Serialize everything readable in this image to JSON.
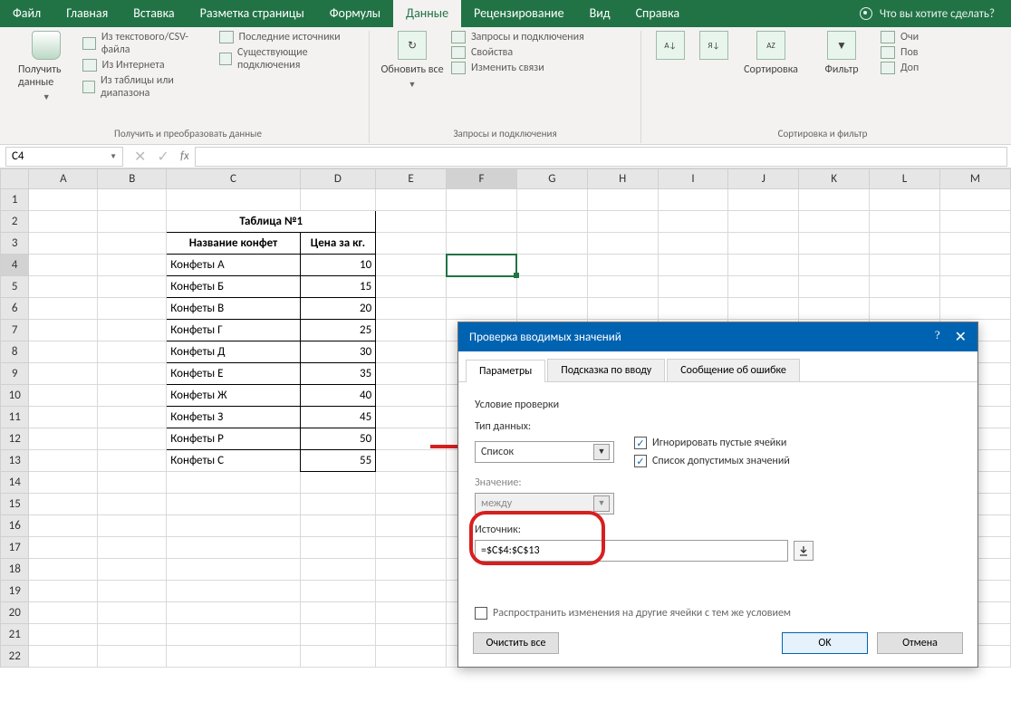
{
  "ribbon": {
    "tabs": [
      "Файл",
      "Главная",
      "Вставка",
      "Разметка страницы",
      "Формулы",
      "Данные",
      "Рецензирование",
      "Вид",
      "Справка"
    ],
    "active_index": 5,
    "tell_me": "Что вы хотите сделать?",
    "group1": {
      "big": "Получить данные",
      "items": [
        "Из текстового/CSV-файла",
        "Из Интернета",
        "Из таблицы или диапазона",
        "Последние источники",
        "Существующие подключения"
      ],
      "label": "Получить и преобразовать данные"
    },
    "group2": {
      "big": "Обновить все",
      "items": [
        "Запросы и подключения",
        "Свойства",
        "Изменить связи"
      ],
      "label": "Запросы и подключения"
    },
    "group3": {
      "sort": "Сортировка",
      "filter": "Фильтр",
      "items": [
        "Очи",
        "Пов",
        "Доп"
      ],
      "label": "Сортировка и фильтр"
    }
  },
  "namebox": "C4",
  "table": {
    "title": "Таблица №1",
    "h1": "Название конфет",
    "h2": "Цена за кг.",
    "rows": [
      {
        "n": "Конфеты А",
        "p": "10"
      },
      {
        "n": "Конфеты Б",
        "p": "15"
      },
      {
        "n": "Конфеты В",
        "p": "20"
      },
      {
        "n": "Конфеты Г",
        "p": "25"
      },
      {
        "n": "Конфеты Д",
        "p": "30"
      },
      {
        "n": "Конфеты Е",
        "p": "35"
      },
      {
        "n": "Конфеты Ж",
        "p": "40"
      },
      {
        "n": "Конфеты З",
        "p": "45"
      },
      {
        "n": "Конфеты Р",
        "p": "50"
      },
      {
        "n": "Конфеты С",
        "p": "55"
      }
    ]
  },
  "cols": [
    "A",
    "B",
    "C",
    "D",
    "E",
    "F",
    "G",
    "H",
    "I",
    "J",
    "K",
    "L",
    "M"
  ],
  "dialog": {
    "title": "Проверка вводимых значений",
    "tabs": [
      "Параметры",
      "Подсказка по вводу",
      "Сообщение об ошибке"
    ],
    "cond_label": "Условие проверки",
    "type_label": "Тип данных:",
    "type_value": "Список",
    "value_label": "Значение:",
    "value_value": "между",
    "chk1": "Игнорировать пустые ячейки",
    "chk2": "Список допустимых значений",
    "src_label": "Источник:",
    "src_value": "=$C$4:$C$13",
    "propagate": "Распространить изменения на другие ячейки с тем же условием",
    "clear": "Очистить все",
    "ok": "OK",
    "cancel": "Отмена"
  }
}
